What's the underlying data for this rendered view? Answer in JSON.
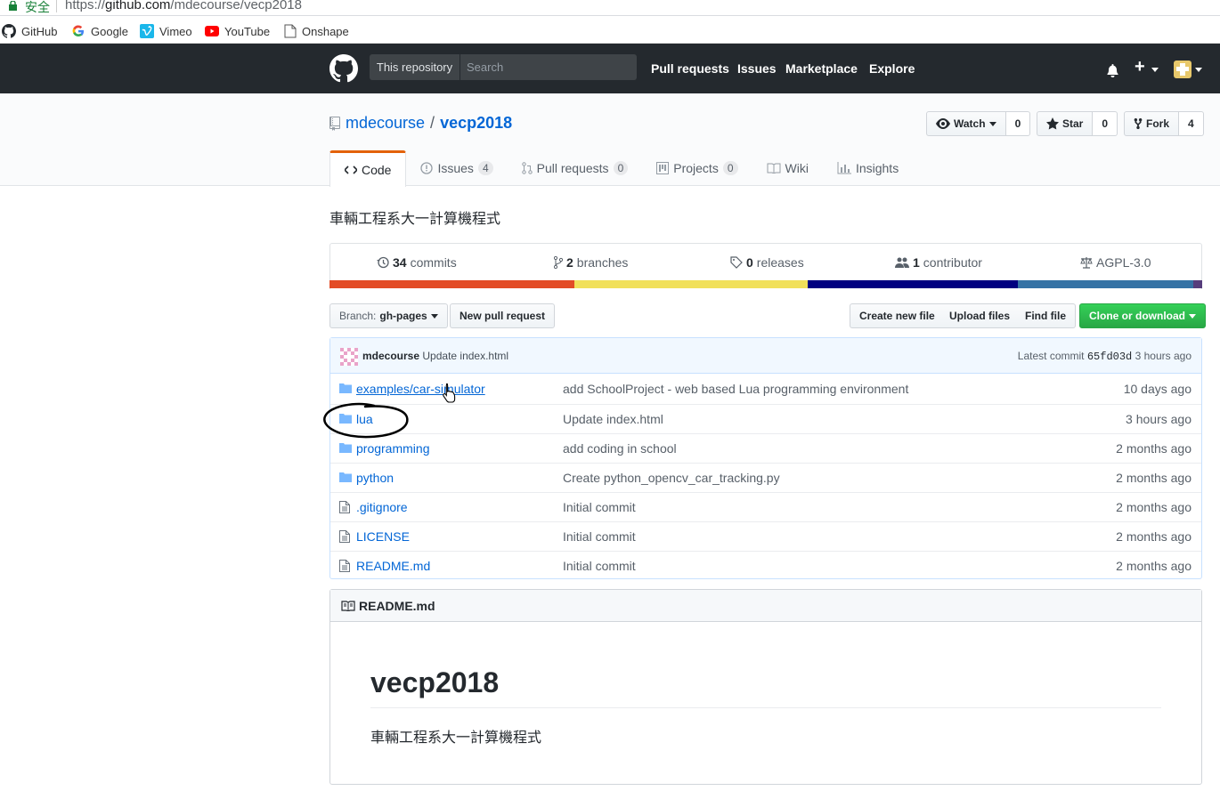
{
  "browser": {
    "secure_label": "安全",
    "url_prefix": "https://",
    "url_host": "github.com",
    "url_path": "/mdecourse/vecp2018",
    "bookmarks": [
      "GitHub",
      "Google",
      "Vimeo",
      "YouTube",
      "Onshape"
    ]
  },
  "header": {
    "scope_label": "This repository",
    "search_placeholder": "Search",
    "nav": [
      "Pull requests",
      "Issues",
      "Marketplace",
      "Explore"
    ],
    "plus_label": "+",
    "bg_color": "#24292e"
  },
  "repo": {
    "owner": "mdecourse",
    "separator": "/",
    "name": "vecp2018",
    "watch_label": "Watch",
    "watch_count": "0",
    "star_label": "Star",
    "star_count": "0",
    "fork_label": "Fork",
    "fork_count": "4",
    "tabs": [
      {
        "label": "Code",
        "count": ""
      },
      {
        "label": "Issues",
        "count": "4"
      },
      {
        "label": "Pull requests",
        "count": "0"
      },
      {
        "label": "Projects",
        "count": "0"
      },
      {
        "label": "Wiki",
        "count": ""
      },
      {
        "label": "Insights",
        "count": ""
      }
    ],
    "description": "車輛工程系大一計算機程式"
  },
  "summary": {
    "commits_num": "34",
    "commits_label": "commits",
    "branches_num": "2",
    "branches_label": "branches",
    "releases_num": "0",
    "releases_label": "releases",
    "contributors_num": "1",
    "contributors_label": "contributor",
    "license": "AGPL-3.0",
    "lang_colors": [
      "#e34c26",
      "#f1e05a",
      "#000080",
      "#3572A5",
      "#563d7c"
    ],
    "lang_fractions": [
      0.281,
      0.267,
      0.241,
      0.201,
      0.01
    ]
  },
  "actions": {
    "branch_prefix": "Branch:",
    "branch_name": "gh-pages",
    "new_pr": "New pull request",
    "create_file": "Create new file",
    "upload_files": "Upload files",
    "find_file": "Find file",
    "clone": "Clone or download"
  },
  "commit": {
    "author": "mdecourse",
    "message": "Update index.html",
    "latest_label": "Latest commit",
    "sha": "65fd03d",
    "age": "3 hours ago"
  },
  "files": [
    {
      "type": "folder-icon",
      "name": "examples/car-simulator",
      "message": "add SchoolProject - web based Lua programming environment",
      "age": "10 days ago"
    },
    {
      "type": "folder-icon",
      "name": "lua",
      "message": "Update index.html",
      "age": "3 hours ago"
    },
    {
      "type": "folder-icon",
      "name": "programming",
      "message": "add coding in school",
      "age": "2 months ago"
    },
    {
      "type": "folder-icon",
      "name": "python",
      "message": "Create python_opencv_car_tracking.py",
      "age": "2 months ago"
    },
    {
      "type": "file-icon",
      "name": ".gitignore",
      "message": "Initial commit",
      "age": "2 months ago"
    },
    {
      "type": "file-icon",
      "name": "LICENSE",
      "message": "Initial commit",
      "age": "2 months ago"
    },
    {
      "type": "file-icon",
      "name": "README.md",
      "message": "Initial commit",
      "age": "2 months ago"
    }
  ],
  "readme": {
    "filename": "README.md",
    "heading": "vecp2018",
    "body": "車輛工程系大一計算機程式"
  }
}
